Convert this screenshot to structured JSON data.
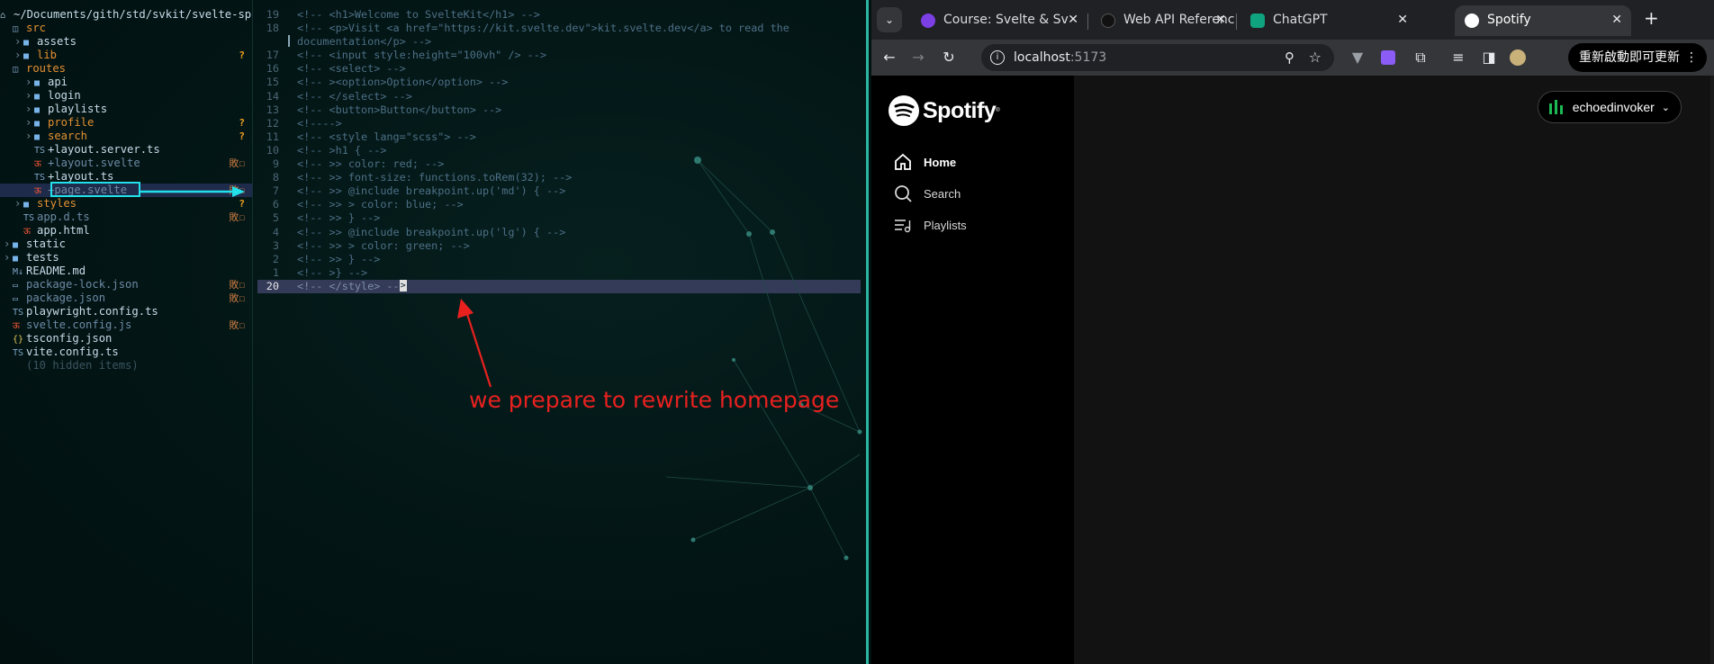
{
  "tree": {
    "root": {
      "glyph": "⌂",
      "label": "~/Documents/gith/std/svkit/svelte-spo"
    },
    "rows": [
      {
        "indent": 0,
        "arrow": "",
        "glyph": "◫",
        "label": "src",
        "cls": "c-orange",
        "badge": "",
        "badgeCls": ""
      },
      {
        "indent": 1,
        "arrow": "›",
        "glyph": "■",
        "label": "assets",
        "cls": "c-dir",
        "badge": "",
        "badgeCls": ""
      },
      {
        "indent": 1,
        "arrow": "›",
        "glyph": "■",
        "label": "lib",
        "cls": "c-orange",
        "badge": "?",
        "badgeCls": "q"
      },
      {
        "indent": 0,
        "arrow": "",
        "glyph": "◫",
        "label": "routes",
        "cls": "c-orange",
        "badge": "",
        "badgeCls": ""
      },
      {
        "indent": 2,
        "arrow": "›",
        "glyph": "■",
        "label": "api",
        "cls": "c-dir",
        "badge": "",
        "badgeCls": ""
      },
      {
        "indent": 2,
        "arrow": "›",
        "glyph": "■",
        "label": "login",
        "cls": "c-dir",
        "badge": "",
        "badgeCls": ""
      },
      {
        "indent": 2,
        "arrow": "›",
        "glyph": "■",
        "label": "playlists",
        "cls": "c-dir",
        "badge": "",
        "badgeCls": ""
      },
      {
        "indent": 2,
        "arrow": "›",
        "glyph": "■",
        "label": "profile",
        "cls": "c-orange",
        "badge": "?",
        "badgeCls": "q"
      },
      {
        "indent": 2,
        "arrow": "›",
        "glyph": "■",
        "label": "search",
        "cls": "c-orange",
        "badge": "?",
        "badgeCls": "q"
      },
      {
        "indent": 2,
        "arrow": "",
        "glyph": "TS",
        "label": "+layout.server.ts",
        "cls": "c-dir",
        "badge": "",
        "badgeCls": ""
      },
      {
        "indent": 2,
        "arrow": "",
        "glyph": "ऊ",
        "label": "+layout.svelte",
        "cls": "c-dim",
        "badge": "敗☐",
        "badgeCls": "edit-mark"
      },
      {
        "indent": 2,
        "arrow": "",
        "glyph": "TS",
        "label": "+layout.ts",
        "cls": "c-dir",
        "badge": "",
        "badgeCls": ""
      },
      {
        "indent": 2,
        "arrow": "",
        "glyph": "ऊ",
        "label": "+page.svelte",
        "cls": "c-dim",
        "badge": "敗☐",
        "badgeCls": "edit-mark",
        "selected": true
      },
      {
        "indent": 1,
        "arrow": "›",
        "glyph": "■",
        "label": "styles",
        "cls": "c-orange",
        "badge": "?",
        "badgeCls": "q"
      },
      {
        "indent": 1,
        "arrow": "",
        "glyph": "TS",
        "label": "app.d.ts",
        "cls": "c-dim",
        "badge": "敗☐",
        "badgeCls": "edit-mark"
      },
      {
        "indent": 1,
        "arrow": "",
        "glyph": "ऊ",
        "label": "app.html",
        "cls": "c-dir",
        "badge": "",
        "badgeCls": ""
      },
      {
        "indent": 0,
        "arrow": "›",
        "glyph": "■",
        "label": "static",
        "cls": "c-dir",
        "badge": "",
        "badgeCls": ""
      },
      {
        "indent": 0,
        "arrow": "›",
        "glyph": "■",
        "label": "tests",
        "cls": "c-dir",
        "badge": "",
        "badgeCls": ""
      },
      {
        "indent": 0,
        "arrow": "",
        "glyph": "M↓",
        "label": "README.md",
        "cls": "c-dir",
        "badge": "",
        "badgeCls": ""
      },
      {
        "indent": 0,
        "arrow": "",
        "glyph": "▭",
        "label": "package-lock.json",
        "cls": "c-dim",
        "badge": "敗☐",
        "badgeCls": "edit-mark"
      },
      {
        "indent": 0,
        "arrow": "",
        "glyph": "▭",
        "label": "package.json",
        "cls": "c-dim",
        "badge": "敗☐",
        "badgeCls": "edit-mark"
      },
      {
        "indent": 0,
        "arrow": "",
        "glyph": "TS",
        "label": "playwright.config.ts",
        "cls": "c-dir",
        "badge": "",
        "badgeCls": ""
      },
      {
        "indent": 0,
        "arrow": "",
        "glyph": "ऊ",
        "label": "svelte.config.js",
        "cls": "c-dim",
        "badge": "敗☐",
        "badgeCls": "edit-mark"
      },
      {
        "indent": 0,
        "arrow": "",
        "glyph": "{}",
        "label": "tsconfig.json",
        "cls": "c-dir",
        "badge": "",
        "badgeCls": ""
      },
      {
        "indent": 0,
        "arrow": "",
        "glyph": "TS",
        "label": "vite.config.ts",
        "cls": "c-dir",
        "badge": "",
        "badgeCls": ""
      },
      {
        "indent": 0,
        "arrow": "",
        "glyph": "",
        "label": "(10 hidden items)",
        "cls": "c-hidden",
        "badge": "",
        "badgeCls": ""
      }
    ]
  },
  "code": [
    {
      "ln": "19",
      "text": "<!-- <h1>Welcome to SvelteKit</h1> -->"
    },
    {
      "ln": "18",
      "text": "<!-- <p>Visit <a href=\"https://kit.svelte.dev\">kit.svelte.dev</a> to read the"
    },
    {
      "ln": "",
      "text": "documentation</p> -->",
      "cursorbar": true
    },
    {
      "ln": "17",
      "text": "<!-- <input style:height=\"100vh\" /> -->"
    },
    {
      "ln": "16",
      "text": "<!-- <select> -->"
    },
    {
      "ln": "15",
      "text": "<!-- ><option>Option</option> -->"
    },
    {
      "ln": "14",
      "text": "<!-- </select> -->"
    },
    {
      "ln": "13",
      "text": "<!-- <button>Button</button> -->"
    },
    {
      "ln": "12",
      "text": "<!---->"
    },
    {
      "ln": "11",
      "text": "<!-- <style lang=\"scss\"> -->"
    },
    {
      "ln": "10",
      "text": "<!-- >h1 { -->"
    },
    {
      "ln": "9",
      "text": "<!-- >> color: red; -->"
    },
    {
      "ln": "8",
      "text": "<!-- >> font-size: functions.toRem(32); -->"
    },
    {
      "ln": "7",
      "text": "<!-- >> @include breakpoint.up('md') { -->"
    },
    {
      "ln": "6",
      "text": "<!-- >> > color: blue; -->"
    },
    {
      "ln": "5",
      "text": "<!-- >> } -->"
    },
    {
      "ln": "4",
      "text": "<!-- >> @include breakpoint.up('lg') { -->"
    },
    {
      "ln": "3",
      "text": "<!-- >> > color: green; -->"
    },
    {
      "ln": "2",
      "text": "<!-- >> } -->"
    },
    {
      "ln": "1",
      "text": "<!-- >} -->"
    },
    {
      "ln": "20",
      "text": "<!-- </style> --",
      "current": true,
      "cursor": ">"
    }
  ],
  "annotation": {
    "text": "we prepare to rewrite homepage",
    "color": "#e8211f"
  },
  "browser": {
    "tabs": [
      {
        "title": "Course: Svelte & Sv",
        "favicon": "course-icon",
        "color": "#7b3fe4"
      },
      {
        "title": "Web API Reference",
        "favicon": "web-api-icon",
        "color": "#111"
      },
      {
        "title": "ChatGPT",
        "favicon": "chatgpt-icon",
        "color": "#10a37f"
      },
      {
        "title": "Spotify",
        "favicon": "spotify-icon",
        "color": "#ffffff",
        "active": true
      }
    ],
    "url_host": "localhost",
    "url_port": ":5173",
    "update_label": "重新啟動即可更新",
    "close_glyph": "✕",
    "new_tab_glyph": "+"
  },
  "spotify": {
    "logo_text": "Spotify",
    "nav": [
      {
        "label": "Home",
        "icon": "home-icon",
        "active": true
      },
      {
        "label": "Search",
        "icon": "search-icon"
      },
      {
        "label": "Playlists",
        "icon": "playlist-icon"
      }
    ],
    "user": {
      "name": "echoedinvoker",
      "accent": "#1db954"
    }
  },
  "colors": {
    "accent": "#2bb6a1",
    "annotation": "#e8211f",
    "selection": "#22e0ea"
  }
}
